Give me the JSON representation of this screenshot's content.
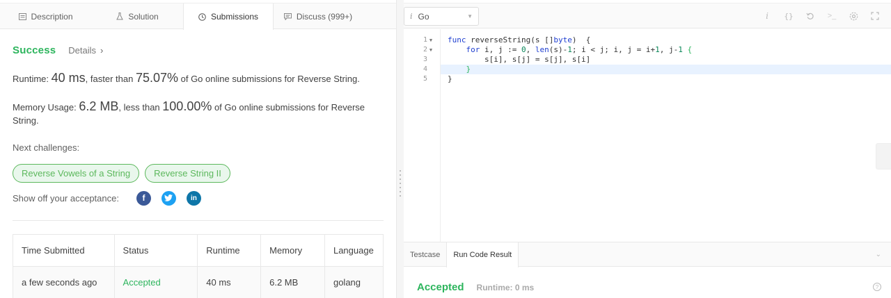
{
  "tabs": [
    {
      "label": "Description",
      "icon": "document-icon"
    },
    {
      "label": "Solution",
      "icon": "flask-icon"
    },
    {
      "label": "Submissions",
      "icon": "clock-icon"
    },
    {
      "label": "Discuss (999+)",
      "icon": "comment-icon"
    }
  ],
  "result": {
    "status": "Success",
    "details_label": "Details",
    "details_chevron": "›"
  },
  "runtime": {
    "prefix": "Runtime: ",
    "value": "40 ms",
    "middle": ", faster than ",
    "percent": "75.07%",
    "suffix": " of Go online submissions for Reverse String."
  },
  "memory": {
    "prefix": "Memory Usage: ",
    "value": "6.2 MB",
    "middle": ", less than ",
    "percent": "100.00%",
    "suffix": " of Go online submissions for Reverse String."
  },
  "next": {
    "label": "Next challenges:",
    "challenges": [
      "Reverse Vowels of a String",
      "Reverse String II"
    ]
  },
  "share": {
    "label": "Show off your acceptance:",
    "facebook": "f",
    "twitter": "t",
    "linkedin": "in"
  },
  "submissions_table": {
    "headers": [
      "Time Submitted",
      "Status",
      "Runtime",
      "Memory",
      "Language"
    ],
    "rows": [
      [
        "a few seconds ago",
        "Accepted",
        "40 ms",
        "6.2 MB",
        "golang"
      ]
    ]
  },
  "editor": {
    "language": "Go",
    "language_icon": "i",
    "line_numbers": [
      "1",
      "2",
      "3",
      "4",
      "5"
    ],
    "toolbar_icons": [
      "info-icon",
      "braces-icon",
      "reset-icon",
      "terminal-icon",
      "settings-icon",
      "fullscreen-icon"
    ]
  },
  "code_lines": {
    "l1": [
      "func",
      " reverseString(s []",
      "byte",
      ")  {"
    ],
    "l2": [
      "    ",
      "for",
      " i, j := ",
      "0",
      ", ",
      "len",
      "(s)-",
      "1",
      "; i < j; i, j = i+",
      "1",
      ", j-",
      "1",
      " {"
    ],
    "l3": "        s[i], s[j] = s[j], s[i]",
    "l4": "    }",
    "l5": "}"
  },
  "bottom_panel": {
    "tabs": [
      "Testcase",
      "Run Code Result"
    ],
    "status": "Accepted",
    "runtime": "Runtime: 0 ms"
  },
  "colors": {
    "success": "#2db55d",
    "keyword": "#1f3fd0",
    "number": "#098658",
    "facebook": "#3b5998",
    "twitter": "#1da1f2",
    "linkedin": "#0e76a8"
  }
}
